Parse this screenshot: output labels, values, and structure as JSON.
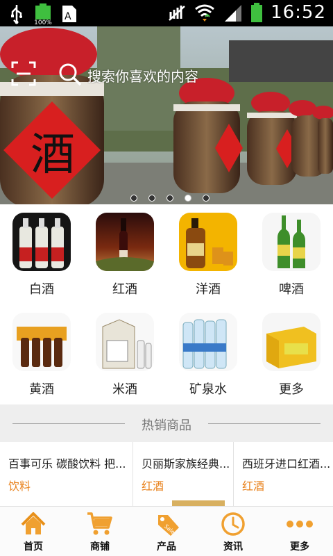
{
  "status_bar": {
    "time": "16:52",
    "battery_percent_text": "100%",
    "icons": [
      "usb-icon",
      "battery-full-icon",
      "keyboard-icon",
      "signal-muted-icon",
      "wifi-icon",
      "cell-signal-icon",
      "battery-icon"
    ]
  },
  "search": {
    "placeholder": "搜索你喜欢的内容",
    "scan_icon": "scan-icon",
    "search_icon": "search-icon"
  },
  "banner": {
    "slide_count": 5,
    "active_index": 3
  },
  "categories": [
    {
      "label": "白酒",
      "icon": "baijiu-bottles-image"
    },
    {
      "label": "红酒",
      "icon": "red-wine-image"
    },
    {
      "label": "洋酒",
      "icon": "whisky-image"
    },
    {
      "label": "啤酒",
      "icon": "beer-image"
    },
    {
      "label": "黄酒",
      "icon": "huangjiu-image"
    },
    {
      "label": "米酒",
      "icon": "rice-wine-image"
    },
    {
      "label": "矿泉水",
      "icon": "mineral-water-image"
    },
    {
      "label": "更多",
      "icon": "more-juice-box-image"
    }
  ],
  "hot_section": {
    "title": "热销商品"
  },
  "products": [
    {
      "name": "百事可乐 碳酸饮料 把...",
      "category": "饮料"
    },
    {
      "name": "贝丽斯家族经典...",
      "category": "红酒"
    },
    {
      "name": "西班牙进口红酒...",
      "category": "红酒"
    }
  ],
  "tabs": [
    {
      "label": "首页",
      "icon": "home-icon"
    },
    {
      "label": "商铺",
      "icon": "cart-icon"
    },
    {
      "label": "产品",
      "icon": "sale-tag-icon"
    },
    {
      "label": "资讯",
      "icon": "clock-icon"
    },
    {
      "label": "更多",
      "icon": "more-dots-icon"
    }
  ],
  "colors": {
    "accent": "#f08c1a",
    "category_text": "#e8801a",
    "banner_jar_red": "#d81f1f"
  }
}
